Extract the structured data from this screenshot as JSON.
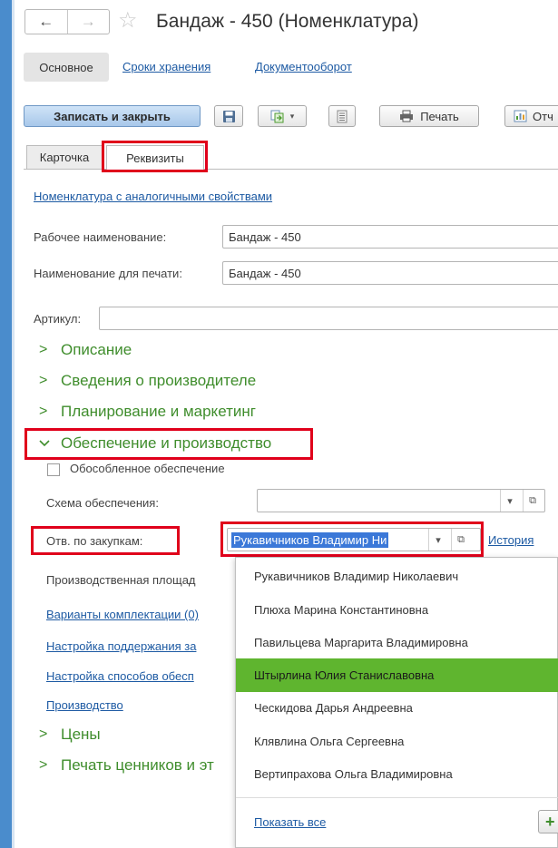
{
  "window": {
    "title": "Бандаж - 450 (Номенклатура)",
    "back_glyph": "←",
    "forward_glyph": "→",
    "star_glyph": "☆"
  },
  "sections": {
    "main": "Основное",
    "storage": "Сроки хранения",
    "docflow": "Документооборот"
  },
  "toolbar": {
    "save_close": "Записать и закрыть",
    "print": "Печать",
    "reports": "Отч"
  },
  "tabs": {
    "card": "Карточка",
    "requisites": "Реквизиты"
  },
  "form": {
    "similar_link": "Номенклатура с аналогичными свойствами",
    "working_name_label": "Рабочее наименование:",
    "working_name_value": "Бандаж - 450",
    "print_name_label": "Наименование для печати:",
    "print_name_value": "Бандаж - 450",
    "article_label": "Артикул:",
    "article_value": "",
    "groups": {
      "description": "Описание",
      "manufacturer": "Сведения о производителе",
      "planning": "Планирование и маркетинг",
      "supply": "Обеспечение и производство",
      "prices": "Цены",
      "price_tags": "Печать ценников и эт"
    },
    "separate_supply_label": "Обособленное обеспечение",
    "supply_scheme_label": "Схема обеспечения:",
    "supply_scheme_value": "",
    "purchaser_label": "Отв. по закупкам:",
    "purchaser_value": "Рукавичников Владимир Ни",
    "history_link": "История",
    "production_area_label": "Производственная площад",
    "kit_variants_link": "Варианты комплектации (0)",
    "maintain_settings_link": "Настройка поддержания за",
    "supply_methods_link": "Настройка способов обесп",
    "production_link": "Производство"
  },
  "dropdown": {
    "items": [
      "Рукавичников Владимир Николаевич",
      "Плюха Марина Константиновна",
      "Павильцева Маргарита Владимировна",
      "Штырлина Юлия Станиславовна",
      "Ческидова Дарья Андреевна",
      "Клявлина Ольга Сергеевна",
      "Вертипрахова Ольга Владимировна"
    ],
    "selected_index": 3,
    "show_all": "Показать все",
    "add_glyph": "+"
  },
  "colors": {
    "accent_green": "#3f8d2c",
    "selection_green": "#5fb52f",
    "highlight_red": "#e0001b",
    "link_blue": "#1d5aa3"
  }
}
